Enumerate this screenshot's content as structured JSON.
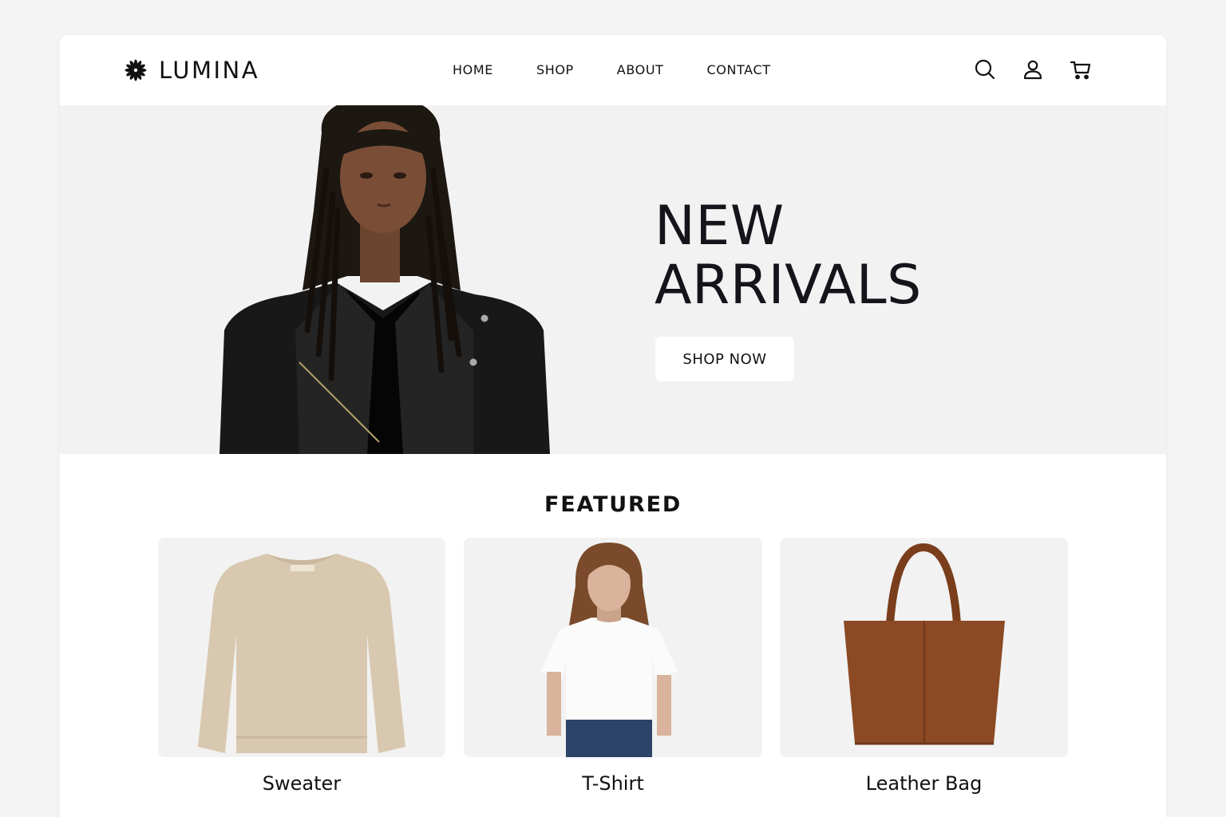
{
  "brand": {
    "name": "LUMINA",
    "icon": "sunburst-logo"
  },
  "nav": {
    "items": [
      "HOME",
      "SHOP",
      "ABOUT",
      "CONTACT"
    ]
  },
  "actions": {
    "icons": [
      "search-icon",
      "user-icon",
      "cart-icon"
    ]
  },
  "hero": {
    "title_line1": "NEW",
    "title_line2": "ARRIVALS",
    "cta_label": "SHOP NOW"
  },
  "featured": {
    "title": "FEATURED",
    "products": [
      {
        "name": "Sweater"
      },
      {
        "name": "T-Shirt"
      },
      {
        "name": "Leather Bag"
      }
    ]
  },
  "colors": {
    "text": "#111111",
    "hero_bg": "#f2f2f2",
    "card_bg": "#f2f2f2",
    "page_bg": "#f4f4f4",
    "leather": "#8b4a24",
    "sweater": "#d9c8b0"
  }
}
